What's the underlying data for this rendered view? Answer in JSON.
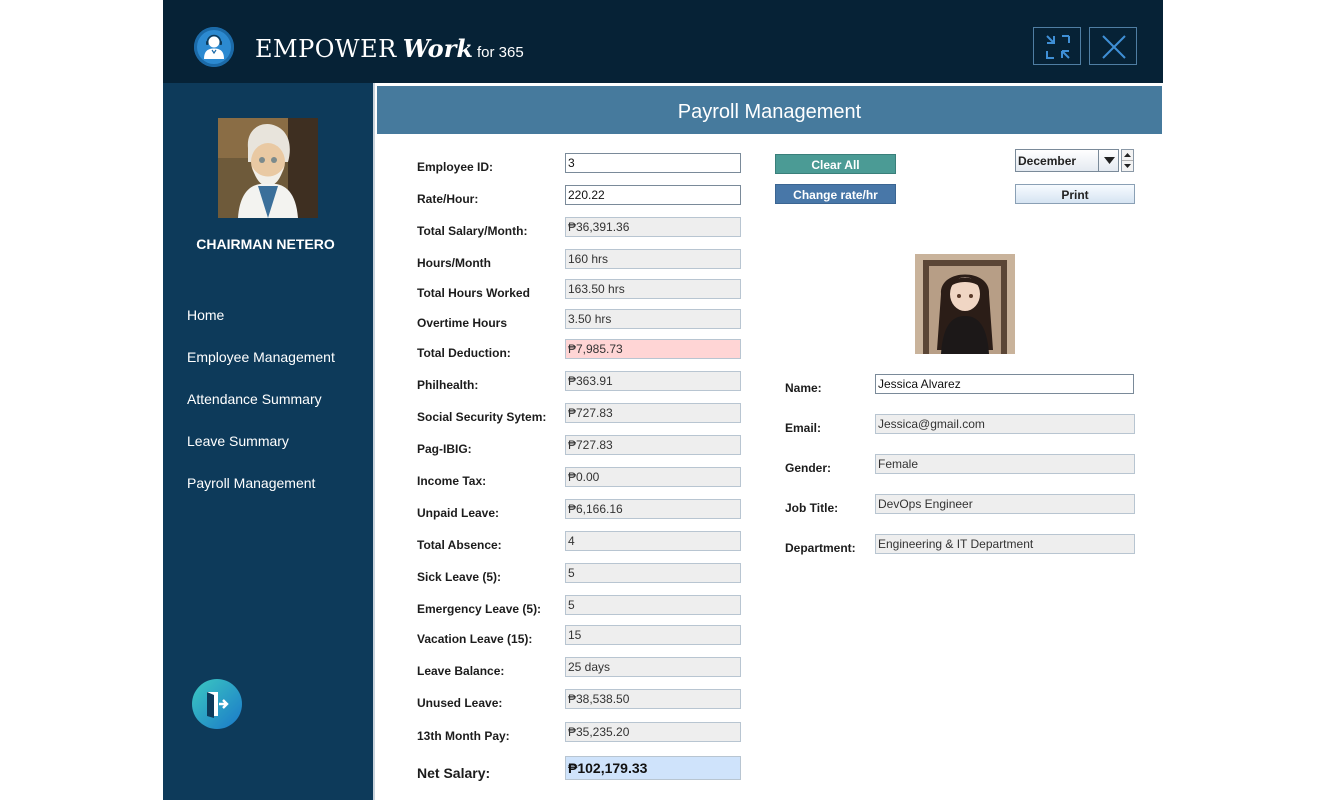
{
  "header": {
    "brand_main": "EMPOWER",
    "brand_work": "Work",
    "brand_suffix": "for 365"
  },
  "sidebar": {
    "user_name": "CHAIRMAN NETERO",
    "items": [
      {
        "label": "Home"
      },
      {
        "label": "Employee Management"
      },
      {
        "label": "Attendance Summary"
      },
      {
        "label": "Leave Summary"
      },
      {
        "label": "Payroll Management"
      }
    ]
  },
  "main": {
    "title": "Payroll Management",
    "clear_all_label": "Clear All",
    "change_rate_label": "Change rate/hr",
    "print_label": "Print",
    "month_selected": "December",
    "fields": [
      {
        "label": "Employee ID:",
        "value": "3"
      },
      {
        "label": "Rate/Hour:",
        "value": "220.22"
      },
      {
        "label": "Total Salary/Month:",
        "value": "₱36,391.36"
      },
      {
        "label": "Hours/Month",
        "value": "160 hrs"
      },
      {
        "label": "Total Hours Worked",
        "value": "163.50 hrs"
      },
      {
        "label": "Overtime Hours",
        "value": "3.50 hrs"
      },
      {
        "label": "Total Deduction:",
        "value": "₱7,985.73"
      },
      {
        "label": "Philhealth:",
        "value": "₱363.91"
      },
      {
        "label": "Social Security Sytem:",
        "value": "₱727.83"
      },
      {
        "label": "Pag-IBIG:",
        "value": "₱727.83"
      },
      {
        "label": "Income Tax:",
        "value": "₱0.00"
      },
      {
        "label": "Unpaid Leave:",
        "value": "₱6,166.16"
      },
      {
        "label": "Total Absence:",
        "value": "4"
      },
      {
        "label": "Sick Leave (5):",
        "value": "5"
      },
      {
        "label": "Emergency Leave (5):",
        "value": "5"
      },
      {
        "label": "Vacation Leave (15):",
        "value": "15"
      },
      {
        "label": "Leave Balance:",
        "value": "25 days"
      },
      {
        "label": "Unused Leave:",
        "value": "₱38,538.50"
      },
      {
        "label": "13th Month Pay:",
        "value": "₱35,235.20"
      },
      {
        "label": "Net Salary:",
        "value": "₱102,179.33"
      }
    ],
    "employee": [
      {
        "label": "Name:",
        "value": "Jessica Alvarez"
      },
      {
        "label": "Email:",
        "value": "Jessica@gmail.com"
      },
      {
        "label": "Gender:",
        "value": "Female"
      },
      {
        "label": "Job Title:",
        "value": "DevOps Engineer"
      },
      {
        "label": "Department:",
        "value": "Engineering & IT Department"
      }
    ]
  },
  "colors": {
    "header_bg": "#062236",
    "sidebar_bg": "#0d3a5a",
    "title_bar": "#467a9d",
    "clear_btn": "#4b9b95",
    "rate_btn": "#4877a8",
    "deduction_bg": "#ffd5d5",
    "net_bg": "#cfe3fb"
  },
  "icons": {
    "logo": "user-headset-icon",
    "minimize": "compress-arrows-icon",
    "close": "close-x-icon",
    "logout": "logout-door-icon",
    "dropdown": "caret-down-icon"
  }
}
